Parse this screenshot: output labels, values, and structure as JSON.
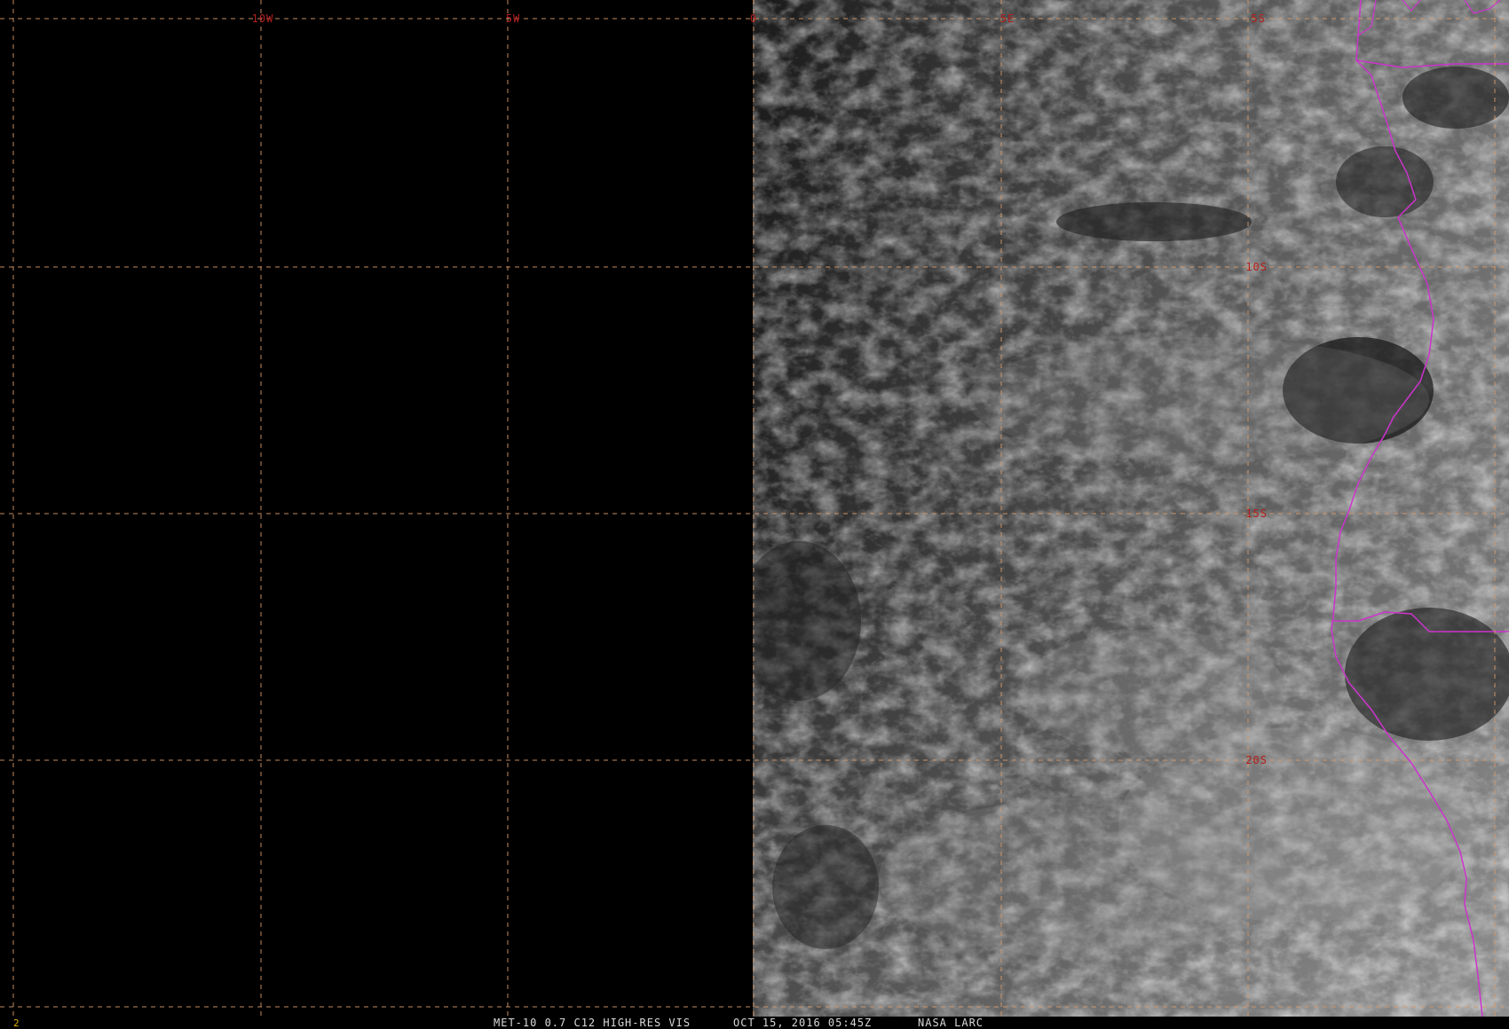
{
  "image": {
    "frame_number": "2",
    "caption": {
      "satellite_product": "MET-10 0.7 C12 HIGH-RES VIS",
      "timestamp": "OCT 15, 2016 05:45Z",
      "source": "NASA LARC"
    }
  },
  "grid": {
    "longitude_labels": [
      "10W",
      "5W",
      "0",
      "5E",
      "5S"
    ],
    "latitude_labels": [
      "10S",
      "15S",
      "20S"
    ],
    "grid_color": "#d89a6a",
    "label_color": "#b41e1e",
    "coastline_color": "#cc33cc"
  },
  "regions": {
    "night_side": "dark (no solar illumination)",
    "day_side": "cloud field over southeast Atlantic and Angola/Namibia coast"
  }
}
